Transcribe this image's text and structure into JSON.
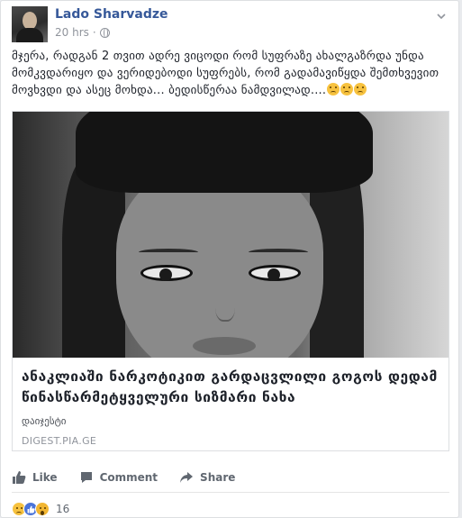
{
  "post": {
    "author": "Lado Sharvadze",
    "time": "20 hrs",
    "privacy_icon": "globe-icon",
    "menu_icon": "chevron-down-icon",
    "text": "მჯერა, რადგან 2 თვით ადრე ვიცოდი რომ სუფრაზე ახალგაზრდა უნდა მომკვდარიყო და ვერიდებოდი სუფრებს, რომ გადამავიწყდა შემთხვევით მოვხვდი და ასეც მოხდა... ბედისწერაა ნამდვილად....",
    "emoji_count": 3
  },
  "link": {
    "title": "ანაკლიაში ნარკოტიკით გარდაცვლილი გოგოს დედამ წინასწარმეტყველური სიზმარი ნახა",
    "description": "დაიჯესტი",
    "domain": "DIGEST.PIA.GE"
  },
  "actions": {
    "like": "Like",
    "comment": "Comment",
    "share": "Share"
  },
  "reactions": {
    "types": [
      "sad",
      "like",
      "wow"
    ],
    "count": "16"
  },
  "colors": {
    "author_link": "#365899",
    "meta": "#90949c",
    "action_text": "#606770",
    "like_blue": "#4a74d9",
    "emoji_yellow": "#f7c23f"
  }
}
